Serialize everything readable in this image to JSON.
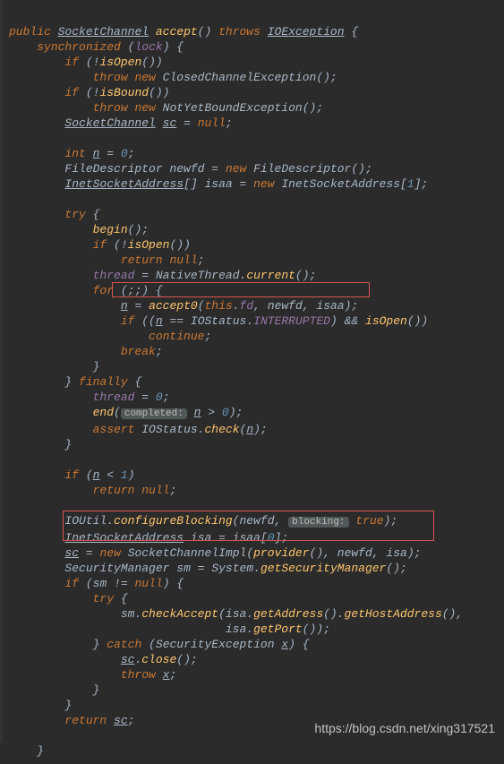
{
  "watermark": "https://blog.csdn.net/xing317521",
  "code": {
    "l1": {
      "public": "public",
      "type": "SocketChannel",
      "name": "accept",
      "throws": "throws",
      "exc": "IOException"
    },
    "l2": {
      "sync": "synchronized",
      "lock": "lock"
    },
    "l3": {
      "if": "if",
      "isopen": "isOpen"
    },
    "l4": {
      "throw": "throw",
      "new": "new",
      "exc": "ClosedChannelException"
    },
    "l5": {
      "if": "if",
      "isbound": "isBound"
    },
    "l6": {
      "throw": "throw",
      "new": "new",
      "exc": "NotYetBoundException"
    },
    "l7": {
      "type": "SocketChannel",
      "var": "sc",
      "null": "null"
    },
    "l8": {
      "int": "int",
      "var": "n",
      "val": "0"
    },
    "l9": {
      "type": "FileDescriptor",
      "var": "newfd",
      "new": "new",
      "ctor": "FileDescriptor"
    },
    "l10": {
      "type": "InetSocketAddress",
      "var": "isaa",
      "new": "new",
      "ctor": "InetSocketAddress",
      "size": "1"
    },
    "l11": {
      "try": "try"
    },
    "l12": {
      "begin": "begin"
    },
    "l13": {
      "if": "if",
      "isopen": "isOpen"
    },
    "l14": {
      "return": "return",
      "null": "null"
    },
    "l15": {
      "thread": "thread",
      "nt": "NativeThread",
      "current": "current"
    },
    "l16": {
      "for": "for"
    },
    "l17": {
      "n": "n",
      "accept0": "accept0",
      "this": "this",
      "fd": "fd",
      "newfd": "newfd",
      "isaa": "isaa"
    },
    "l18": {
      "if": "if",
      "n": "n",
      "ios": "IOStatus",
      "intr": "INTERRUPTED",
      "isopen": "isOpen"
    },
    "l19": {
      "continue": "continue"
    },
    "l20": {
      "break": "break"
    },
    "l21": {
      "finally": "finally"
    },
    "l22": {
      "thread": "thread",
      "val": "0"
    },
    "l23": {
      "end": "end",
      "badge": "completed:",
      "n": "n",
      "val": "0"
    },
    "l24": {
      "assert": "assert",
      "ios": "IOStatus",
      "check": "check",
      "n": "n"
    },
    "l25": {
      "if": "if",
      "n": "n",
      "val": "1"
    },
    "l26": {
      "return": "return",
      "null": "null"
    },
    "l27": {
      "io": "IOUtil",
      "cfg": "configureBlocking",
      "newfd": "newfd",
      "badge": "blocking:",
      "true": "true"
    },
    "l28": {
      "type": "InetSocketAddress",
      "isa": "isa",
      "isaa": "isaa",
      "idx": "0"
    },
    "l29": {
      "sc": "sc",
      "new": "new",
      "impl": "SocketChannelImpl",
      "provider": "provider",
      "newfd": "newfd",
      "isa": "isa"
    },
    "l30": {
      "type": "SecurityManager",
      "sm": "sm",
      "sys": "System",
      "gsm": "getSecurityManager"
    },
    "l31": {
      "if": "if",
      "sm": "sm",
      "null": "null"
    },
    "l32": {
      "try": "try"
    },
    "l33": {
      "sm": "sm",
      "ca": "checkAccept",
      "isa": "isa",
      "ga": "getAddress",
      "gha": "getHostAddress"
    },
    "l34": {
      "isa": "isa",
      "gp": "getPort"
    },
    "l35": {
      "catch": "catch",
      "se": "SecurityException",
      "x": "x"
    },
    "l36": {
      "sc": "sc",
      "close": "close"
    },
    "l37": {
      "throw": "throw",
      "x": "x"
    },
    "l38": {
      "return": "return",
      "sc": "sc"
    }
  }
}
